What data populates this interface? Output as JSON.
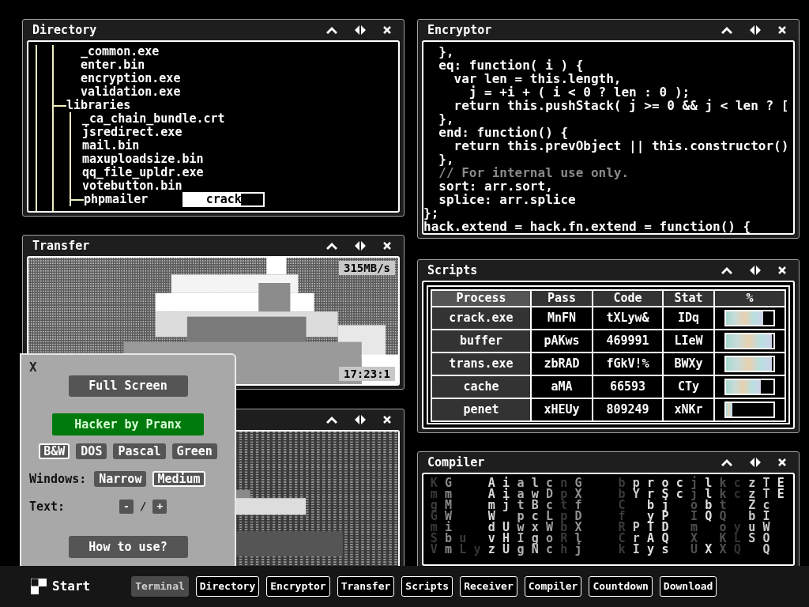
{
  "directory": {
    "title": "Directory",
    "tree": [
      {
        "kind": "folder",
        "children": [
          {
            "kind": "file",
            "name": "_common.exe"
          },
          {
            "kind": "file",
            "name": "enter.bin"
          },
          {
            "kind": "file",
            "name": "encryption.exe"
          },
          {
            "kind": "file",
            "name": "validation.exe"
          }
        ]
      },
      {
        "kind": "folder",
        "name": "libraries",
        "children": [
          {
            "kind": "file",
            "name": "_ca_chain_bundle.crt"
          },
          {
            "kind": "file",
            "name": "jsredirect.exe"
          },
          {
            "kind": "file",
            "name": "mail.bin"
          },
          {
            "kind": "file",
            "name": "maxuploadsize.bin"
          },
          {
            "kind": "file",
            "name": "qq_file_upldr.exe"
          },
          {
            "kind": "file",
            "name": "votebutton.bin"
          },
          {
            "kind": "folder",
            "name": "phpmailer",
            "action": {
              "label": "crack",
              "level": 0.72
            }
          }
        ]
      }
    ]
  },
  "transfer": {
    "title": "Transfer",
    "speed": "315MB/s",
    "time": "17:23:1"
  },
  "encryptor": {
    "title": "Encryptor",
    "lines": [
      {
        "kind": "code",
        "text": "  },"
      },
      {
        "kind": "code",
        "text": "  eq: function( i ) {"
      },
      {
        "kind": "code",
        "text": "    var len = this.length,"
      },
      {
        "kind": "code",
        "text": "      j = +i + ( i < 0 ? len : 0 );"
      },
      {
        "kind": "code",
        "text": "    return this.pushStack( j >= 0 && j < len ? ["
      },
      {
        "kind": "code",
        "text": "  },"
      },
      {
        "kind": "code",
        "text": "  end: function() {"
      },
      {
        "kind": "code",
        "text": "    return this.prevObject || this.constructor()"
      },
      {
        "kind": "code",
        "text": "  },"
      },
      {
        "kind": "comment",
        "text": "  // For internal use only."
      },
      {
        "kind": "code",
        "text": "  sort: arr.sort,"
      },
      {
        "kind": "code",
        "text": "  splice: arr.splice"
      },
      {
        "kind": "code",
        "text": "};"
      },
      {
        "kind": "code",
        "text": "hack.extend = hack.fn.extend = function() {"
      }
    ]
  },
  "scripts": {
    "title": "Scripts",
    "columns": [
      "Process",
      "Pass",
      "Code",
      "Stat",
      "%"
    ],
    "rows": [
      {
        "process": "crack.exe",
        "pass": "MnFN",
        "code": "tXLyw&",
        "stat": "IDq",
        "level": 0.78
      },
      {
        "process": "buffer",
        "pass": "pAKws",
        "code": "469991",
        "stat": "LIeW",
        "level": 0.97
      },
      {
        "process": "trans.exe",
        "pass": "zbRAD",
        "code": "fGkV!%",
        "stat": "BWXy",
        "level": 0.97
      },
      {
        "process": "cache",
        "pass": "aMA",
        "code": "66593",
        "stat": "CTy",
        "level": 0.74
      },
      {
        "process": "penet",
        "pass": "xHEUy",
        "code": "809249",
        "stat": "xNKr",
        "level": 0.13
      }
    ]
  },
  "compiler": {
    "title": "Compiler",
    "columns": [
      {
        "text": "KmgGmSV",
        "color": "#3a3a3a"
      },
      {
        "text": "GmMWibm",
        "color": "#8a8a8a"
      },
      {
        "text": "     uL",
        "color": "#3a3a3a"
      },
      {
        "text": "      y",
        "color": "#333333"
      },
      {
        "text": "AAmWdvz",
        "color": "#d8d8d8"
      },
      {
        "text": "iij UHU",
        "color": "#d8d8d8"
      },
      {
        "text": "aatpwIg",
        "color": "#b0b0b0"
      },
      {
        "text": "lwBcxgN",
        "color": "#c0c0c0"
      },
      {
        "text": "cDcLWoc",
        "color": "#a0a0a0"
      },
      {
        "text": "nptpbRh",
        "color": "#3a3a3a"
      },
      {
        "text": "GXfDXlj",
        "color": "#909090"
      },
      {
        "text": "bbCfRCk",
        "color": "#3a3a3a",
        "gap_before": true
      },
      {
        "text": "pY  PrI",
        "color": "#c8c8c8"
      },
      {
        "text": "rrbyTAy",
        "color": "#e0e0e0"
      },
      {
        "text": "oSjPDQs",
        "color": "#e0e0e0"
      },
      {
        "text": "cc",
        "color": "#e0e0e0"
      },
      {
        "text": "jjoImXU",
        "color": "#505050"
      },
      {
        "text": "llbQ  X",
        "color": "#e0e0e0"
      },
      {
        "text": "kktQoKX",
        "color": "#505050"
      },
      {
        "text": "cc  yLQ",
        "color": "#333333"
      },
      {
        "text": "zzZbuS",
        "color": "#c8c8c8"
      },
      {
        "text": "TTcIWOQ",
        "color": "#c8c8c8"
      },
      {
        "text": "EE",
        "color": "#e0e0e0"
      }
    ]
  },
  "settings": {
    "close": "X",
    "full_screen": "Full Screen",
    "brand": "Hacker by Pranx",
    "themes": [
      {
        "label": "B&W",
        "selected": true
      },
      {
        "label": "DOS",
        "selected": false
      },
      {
        "label": "Pascal",
        "selected": false
      },
      {
        "label": "Green",
        "selected": false
      }
    ],
    "windows_label": "Windows:",
    "window_sizes": [
      {
        "label": "Narrow",
        "selected": false
      },
      {
        "label": "Medium",
        "selected": true
      }
    ],
    "text_label": "Text:",
    "text_minus": "-",
    "text_separator": "/",
    "text_plus": "+",
    "help": "How to use?"
  },
  "taskbar": {
    "start": "Start",
    "tasks": [
      {
        "label": "Terminal",
        "selected": true
      },
      {
        "label": "Directory",
        "selected": false
      },
      {
        "label": "Encryptor",
        "selected": false
      },
      {
        "label": "Transfer",
        "selected": false
      },
      {
        "label": "Scripts",
        "selected": false
      },
      {
        "label": "Receiver",
        "selected": false
      },
      {
        "label": "Compiler",
        "selected": false
      },
      {
        "label": "Countdown",
        "selected": false
      },
      {
        "label": "Download",
        "selected": false
      }
    ]
  }
}
